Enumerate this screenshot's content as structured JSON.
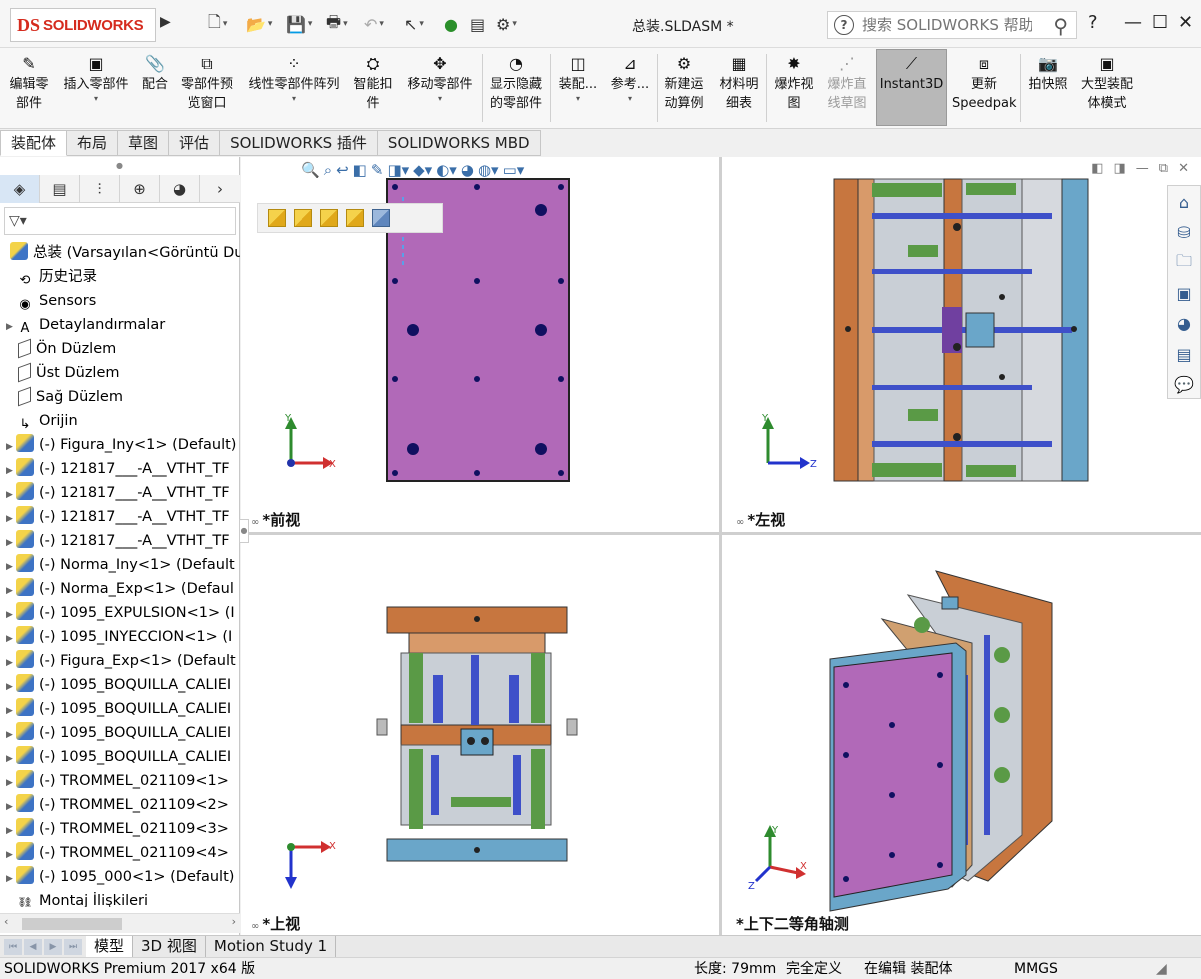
{
  "app": {
    "logo_ds": "DS",
    "logo_text": "SOLIDWORKS",
    "doc_title": "总装.SLDASM *",
    "help_placeholder": "搜索 SOLIDWORKS 帮助",
    "help_btn": "?",
    "min_btn": "—",
    "max_btn": "☐",
    "close_btn": "✕"
  },
  "ribbon": {
    "edit_component": "编辑零部件",
    "insert_component": "插入零部件",
    "mate": "配合",
    "preview_window": "零部件预览窗口",
    "linear_pattern": "线性零部件阵列",
    "smart_fasteners": "智能扣件",
    "move_component": "移动零部件",
    "show_hidden": "显示隐藏的零部件",
    "assembly_features": "装配...",
    "reference": "参考...",
    "new_motion_study": "新建运动算例",
    "bom": "材料明细表",
    "exploded_view": "爆炸视图",
    "explode_line_sketch": "爆炸直线草图",
    "instant3d": "Instant3D",
    "update_speedpak": "更新Speedpak",
    "snapshot": "拍快照",
    "large_assembly": "大型装配体模式"
  },
  "cmtabs": [
    "装配体",
    "布局",
    "草图",
    "评估",
    "SOLIDWORKS 插件",
    "SOLIDWORKS MBD"
  ],
  "fm": {
    "filter_icon": "▽▾",
    "tree": [
      {
        "label": "总装  (Varsayılan<Görüntü Du",
        "icon": "asm",
        "exp": "",
        "indent": 0
      },
      {
        "label": "历史记录",
        "icon": "history",
        "exp": "",
        "indent": 1
      },
      {
        "label": "Sensors",
        "icon": "sensor",
        "exp": "",
        "indent": 1
      },
      {
        "label": "Detaylandırmalar",
        "icon": "annot",
        "exp": "▶",
        "indent": 1
      },
      {
        "label": "Ön Düzlem",
        "icon": "plane",
        "exp": "",
        "indent": 1
      },
      {
        "label": "Üst Düzlem",
        "icon": "plane",
        "exp": "",
        "indent": 1
      },
      {
        "label": "Sağ Düzlem",
        "icon": "plane",
        "exp": "",
        "indent": 1
      },
      {
        "label": "Orijin",
        "icon": "origin",
        "exp": "",
        "indent": 1
      },
      {
        "label": "(-) Figura_Iny<1> (Default)",
        "icon": "part",
        "exp": "▶",
        "indent": 1
      },
      {
        "label": "(-) 121817___-A__VTHT_TF",
        "icon": "part",
        "exp": "▶",
        "indent": 1
      },
      {
        "label": "(-) 121817___-A__VTHT_TF",
        "icon": "part",
        "exp": "▶",
        "indent": 1
      },
      {
        "label": "(-) 121817___-A__VTHT_TF",
        "icon": "part",
        "exp": "▶",
        "indent": 1
      },
      {
        "label": "(-) 121817___-A__VTHT_TF",
        "icon": "part",
        "exp": "▶",
        "indent": 1
      },
      {
        "label": "(-) Norma_Iny<1> (Default",
        "icon": "part",
        "exp": "▶",
        "indent": 1
      },
      {
        "label": "(-) Norma_Exp<1> (Defaul",
        "icon": "part",
        "exp": "▶",
        "indent": 1
      },
      {
        "label": "(-) 1095_EXPULSION<1> (I",
        "icon": "part",
        "exp": "▶",
        "indent": 1
      },
      {
        "label": "(-) 1095_INYECCION<1> (I",
        "icon": "part",
        "exp": "▶",
        "indent": 1
      },
      {
        "label": "(-) Figura_Exp<1> (Default",
        "icon": "part",
        "exp": "▶",
        "indent": 1
      },
      {
        "label": "(-) 1095_BOQUILLA_CALIEI",
        "icon": "part",
        "exp": "▶",
        "indent": 1
      },
      {
        "label": "(-) 1095_BOQUILLA_CALIEI",
        "icon": "part",
        "exp": "▶",
        "indent": 1
      },
      {
        "label": "(-) 1095_BOQUILLA_CALIEI",
        "icon": "part",
        "exp": "▶",
        "indent": 1
      },
      {
        "label": "(-) 1095_BOQUILLA_CALIEI",
        "icon": "part",
        "exp": "▶",
        "indent": 1
      },
      {
        "label": "(-) TROMMEL_021109<1>",
        "icon": "part",
        "exp": "▶",
        "indent": 1
      },
      {
        "label": "(-) TROMMEL_021109<2>",
        "icon": "part",
        "exp": "▶",
        "indent": 1
      },
      {
        "label": "(-) TROMMEL_021109<3>",
        "icon": "part",
        "exp": "▶",
        "indent": 1
      },
      {
        "label": "(-) TROMMEL_021109<4>",
        "icon": "part",
        "exp": "▶",
        "indent": 1
      },
      {
        "label": "(-) 1095_000<1> (Default)",
        "icon": "part",
        "exp": "▶",
        "indent": 1
      },
      {
        "label": "Montaj İlişkileri",
        "icon": "mates",
        "exp": "",
        "indent": 1
      }
    ]
  },
  "viewports": {
    "front": "*前视",
    "left": "*左视",
    "top": "*上视",
    "iso": "*上下二等角轴测"
  },
  "triad": {
    "x": "X",
    "y": "Y",
    "z": "Z"
  },
  "bottom_tabs": [
    "模型",
    "3D 视图",
    "Motion Study 1"
  ],
  "status": {
    "product": "SOLIDWORKS Premium 2017 x64 版",
    "length": "长度: 79mm",
    "defined": "完全定义",
    "editing": "在编辑 装配体",
    "units": "MMGS"
  },
  "colors": {
    "plate_purple": "#b169b8",
    "plate_orange": "#c7763f",
    "plate_blue": "#6aa6c9",
    "pin_green": "#5a9a46",
    "pin_blue": "#3e50c9",
    "brand_red": "#d52b1e"
  }
}
